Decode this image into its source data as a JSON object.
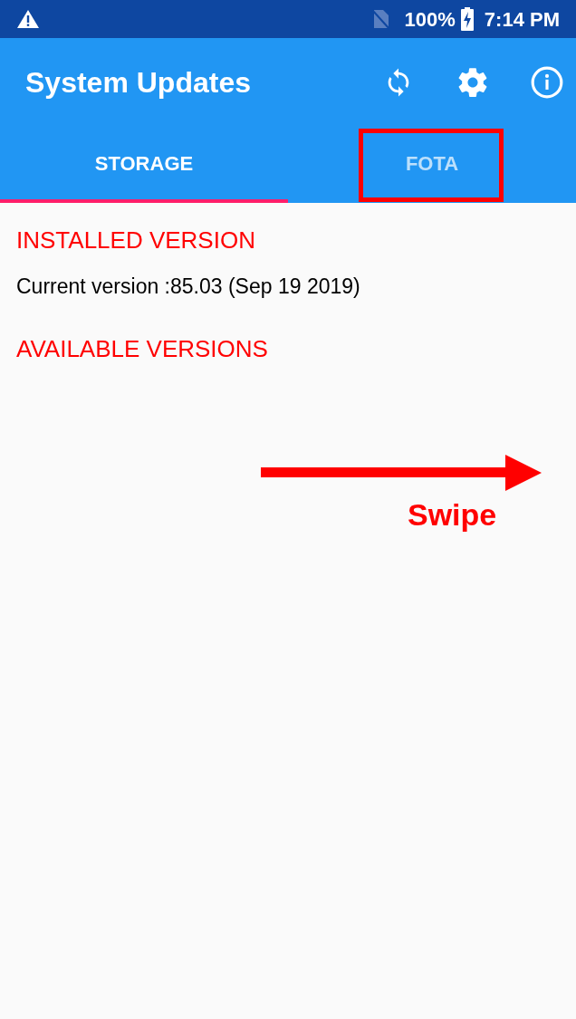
{
  "status_bar": {
    "battery": "100%",
    "time": "7:14 PM"
  },
  "app_bar": {
    "title": "System Updates"
  },
  "tabs": [
    {
      "label": "STORAGE",
      "selected": true,
      "highlighted": false
    },
    {
      "label": "FOTA",
      "selected": false,
      "highlighted": true
    }
  ],
  "content": {
    "installed_heading": "INSTALLED VERSION",
    "current_version": "Current version :85.03 (Sep 19 2019)",
    "available_heading": "AVAILABLE VERSIONS"
  },
  "annotation": {
    "label": "Swipe"
  }
}
